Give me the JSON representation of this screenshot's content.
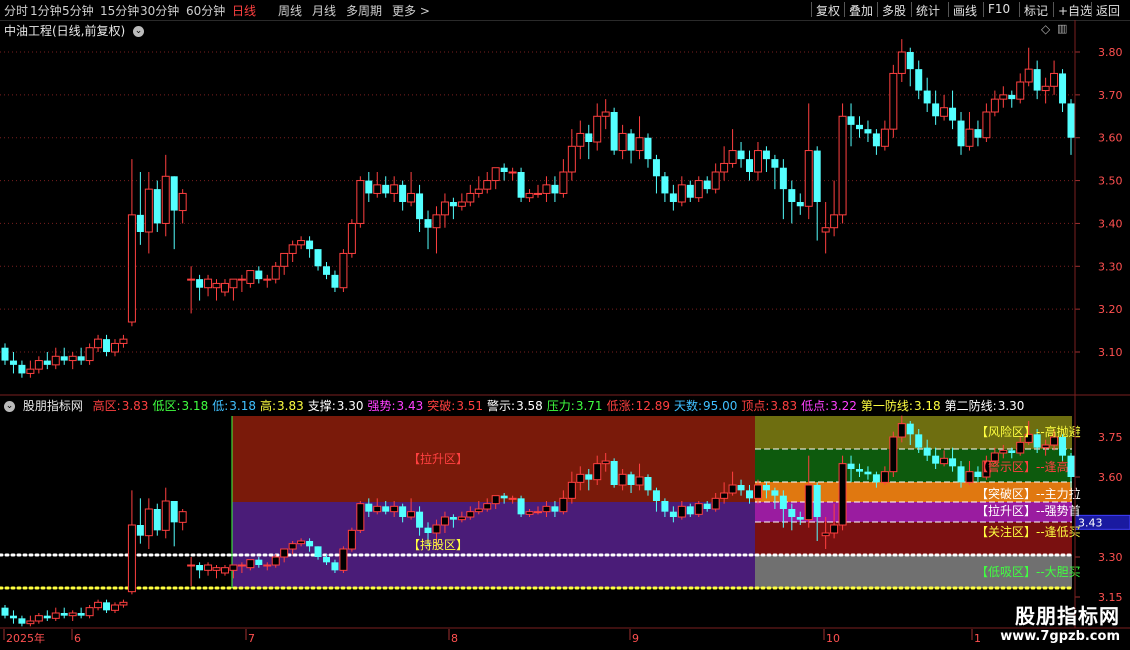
{
  "toolbar": {
    "left": [
      "分时",
      "1分钟",
      "5分钟",
      "15分钟",
      "30分钟",
      "60分钟",
      "日线",
      "周线",
      "月线",
      "多周期",
      "更多 >"
    ],
    "active": "日线",
    "right": [
      "复权",
      "叠加",
      "多股",
      "统计",
      "画线",
      "F10",
      "标记",
      "+自选",
      "返回"
    ]
  },
  "title": "中油工程(日线,前复权)",
  "price_axis": [
    "3.80",
    "3.70",
    "3.60",
    "3.50",
    "3.40",
    "3.30",
    "3.20",
    "3.10"
  ],
  "indicator": {
    "name": "股朋指标网",
    "items": [
      {
        "label": "高区:",
        "value": "3.83",
        "color": "#ff4040"
      },
      {
        "label": "低区:",
        "value": "3.18",
        "color": "#40ff40"
      },
      {
        "label": "低:",
        "value": "3.18",
        "color": "#40c0ff"
      },
      {
        "label": "高:",
        "value": "3.83",
        "color": "#ffff40"
      },
      {
        "label": "支撑:",
        "value": "3.30",
        "color": "#ffffff"
      },
      {
        "label": "强势:",
        "value": "3.43",
        "color": "#ff40ff"
      },
      {
        "label": "突破:",
        "value": "3.51",
        "color": "#ff4040"
      },
      {
        "label": "警示:",
        "value": "3.58",
        "color": "#ffffff"
      },
      {
        "label": "压力:",
        "value": "3.71",
        "color": "#40ff40"
      },
      {
        "label": "低涨:",
        "value": "12.89",
        "color": "#ff4040"
      },
      {
        "label": "天数:",
        "value": "95.00",
        "color": "#40c0ff"
      },
      {
        "label": "顶点:",
        "value": "3.83",
        "color": "#ff4040"
      },
      {
        "label": "低点:",
        "value": "3.22",
        "color": "#ff40ff"
      },
      {
        "label": "第一防线:",
        "value": "3.18",
        "color": "#ffff40"
      },
      {
        "label": "第二防线:",
        "value": "3.30",
        "color": "#ffffff"
      }
    ],
    "axis": [
      "3.75",
      "3.60",
      "3.43",
      "3.30",
      "3.15"
    ],
    "current_tag": "3.43",
    "zone_labels": [
      "【拉升区】",
      "【持股区】"
    ],
    "right_labels": [
      {
        "text": "【风险区】--高抛避",
        "color": "#ffff40"
      },
      {
        "text": "【警示区】--逢高",
        "color": "#ff4040"
      },
      {
        "text": "【突破区】--主力拉",
        "color": "#ffffff"
      },
      {
        "text": "【拉升区】--强势首",
        "color": "#ffffff"
      },
      {
        "text": "【关注区】--逢低买",
        "color": "#ffff40"
      },
      {
        "text": "【低吸区】--大胆买",
        "color": "#40ff40"
      }
    ]
  },
  "date_axis": [
    "2025年",
    "6",
    "7",
    "8",
    "9",
    "10",
    "1"
  ],
  "watermark": {
    "big": "股朋指标网",
    "small": "www.7gpzb.com"
  },
  "colors": {
    "up": "#ff4040",
    "down": "#54ffff",
    "grid": "#7a1f1f"
  },
  "candles": [
    [
      3.11,
      3.08,
      3.12,
      3.07
    ],
    [
      3.08,
      3.07,
      3.1,
      3.05
    ],
    [
      3.07,
      3.05,
      3.08,
      3.04
    ],
    [
      3.05,
      3.06,
      3.08,
      3.04
    ],
    [
      3.06,
      3.08,
      3.09,
      3.05
    ],
    [
      3.08,
      3.07,
      3.1,
      3.06
    ],
    [
      3.07,
      3.09,
      3.11,
      3.06
    ],
    [
      3.09,
      3.08,
      3.11,
      3.07
    ],
    [
      3.08,
      3.09,
      3.1,
      3.06
    ],
    [
      3.09,
      3.08,
      3.11,
      3.07
    ],
    [
      3.08,
      3.11,
      3.12,
      3.07
    ],
    [
      3.11,
      3.13,
      3.14,
      3.1
    ],
    [
      3.13,
      3.1,
      3.14,
      3.09
    ],
    [
      3.1,
      3.12,
      3.13,
      3.09
    ],
    [
      3.12,
      3.13,
      3.14,
      3.11
    ],
    [
      3.17,
      3.42,
      3.55,
      3.16
    ],
    [
      3.42,
      3.38,
      3.52,
      3.35
    ],
    [
      3.38,
      3.48,
      3.52,
      3.33
    ],
    [
      3.48,
      3.4,
      3.5,
      3.38
    ],
    [
      3.4,
      3.51,
      3.56,
      3.37
    ],
    [
      3.51,
      3.43,
      3.51,
      3.34
    ],
    [
      3.43,
      3.47,
      3.48,
      3.4
    ],
    [
      3.27,
      3.27,
      3.3,
      3.19
    ],
    [
      3.27,
      3.25,
      3.28,
      3.22
    ],
    [
      3.25,
      3.27,
      3.28,
      3.23
    ],
    [
      3.25,
      3.26,
      3.27,
      3.22
    ],
    [
      3.24,
      3.26,
      3.27,
      3.23
    ],
    [
      3.25,
      3.27,
      3.27,
      3.22
    ],
    [
      3.27,
      3.27,
      3.28,
      3.24
    ],
    [
      3.26,
      3.29,
      3.29,
      3.25
    ],
    [
      3.29,
      3.27,
      3.3,
      3.26
    ],
    [
      3.27,
      3.27,
      3.28,
      3.25
    ],
    [
      3.27,
      3.3,
      3.31,
      3.26
    ],
    [
      3.3,
      3.33,
      3.33,
      3.28
    ],
    [
      3.33,
      3.35,
      3.36,
      3.31
    ],
    [
      3.35,
      3.36,
      3.37,
      3.34
    ],
    [
      3.36,
      3.34,
      3.37,
      3.32
    ],
    [
      3.34,
      3.3,
      3.34,
      3.29
    ],
    [
      3.3,
      3.28,
      3.31,
      3.27
    ],
    [
      3.28,
      3.25,
      3.29,
      3.24
    ],
    [
      3.25,
      3.33,
      3.34,
      3.24
    ],
    [
      3.33,
      3.4,
      3.41,
      3.32
    ],
    [
      3.4,
      3.5,
      3.51,
      3.39
    ],
    [
      3.5,
      3.47,
      3.52,
      3.45
    ],
    [
      3.47,
      3.49,
      3.52,
      3.46
    ],
    [
      3.49,
      3.47,
      3.51,
      3.46
    ],
    [
      3.47,
      3.49,
      3.51,
      3.45
    ],
    [
      3.49,
      3.45,
      3.5,
      3.43
    ],
    [
      3.45,
      3.47,
      3.52,
      3.44
    ],
    [
      3.47,
      3.41,
      3.49,
      3.38
    ],
    [
      3.41,
      3.39,
      3.43,
      3.34
    ],
    [
      3.39,
      3.42,
      3.44,
      3.33
    ],
    [
      3.42,
      3.45,
      3.47,
      3.39
    ],
    [
      3.45,
      3.44,
      3.46,
      3.41
    ],
    [
      3.44,
      3.45,
      3.47,
      3.43
    ],
    [
      3.45,
      3.47,
      3.49,
      3.44
    ],
    [
      3.47,
      3.48,
      3.51,
      3.46
    ],
    [
      3.48,
      3.5,
      3.52,
      3.47
    ],
    [
      3.5,
      3.53,
      3.53,
      3.48
    ],
    [
      3.53,
      3.52,
      3.54,
      3.5
    ],
    [
      3.52,
      3.52,
      3.53,
      3.5
    ],
    [
      3.52,
      3.46,
      3.53,
      3.45
    ],
    [
      3.46,
      3.47,
      3.48,
      3.45
    ],
    [
      3.47,
      3.47,
      3.49,
      3.46
    ],
    [
      3.47,
      3.49,
      3.51,
      3.45
    ],
    [
      3.49,
      3.47,
      3.51,
      3.45
    ],
    [
      3.47,
      3.52,
      3.55,
      3.46
    ],
    [
      3.52,
      3.58,
      3.62,
      3.5
    ],
    [
      3.58,
      3.61,
      3.64,
      3.55
    ],
    [
      3.61,
      3.59,
      3.63,
      3.55
    ],
    [
      3.59,
      3.65,
      3.68,
      3.57
    ],
    [
      3.65,
      3.66,
      3.69,
      3.62
    ],
    [
      3.66,
      3.57,
      3.67,
      3.56
    ],
    [
      3.57,
      3.61,
      3.63,
      3.55
    ],
    [
      3.61,
      3.57,
      3.62,
      3.54
    ],
    [
      3.57,
      3.6,
      3.65,
      3.55
    ],
    [
      3.6,
      3.55,
      3.61,
      3.53
    ],
    [
      3.55,
      3.51,
      3.56,
      3.47
    ],
    [
      3.51,
      3.47,
      3.52,
      3.45
    ],
    [
      3.47,
      3.45,
      3.49,
      3.43
    ],
    [
      3.45,
      3.49,
      3.51,
      3.44
    ],
    [
      3.49,
      3.46,
      3.5,
      3.45
    ],
    [
      3.46,
      3.5,
      3.51,
      3.45
    ],
    [
      3.5,
      3.48,
      3.51,
      3.47
    ],
    [
      3.48,
      3.52,
      3.54,
      3.47
    ],
    [
      3.52,
      3.54,
      3.58,
      3.5
    ],
    [
      3.54,
      3.57,
      3.62,
      3.53
    ],
    [
      3.57,
      3.55,
      3.59,
      3.53
    ],
    [
      3.55,
      3.52,
      3.57,
      3.5
    ],
    [
      3.52,
      3.57,
      3.59,
      3.5
    ],
    [
      3.57,
      3.55,
      3.58,
      3.52
    ],
    [
      3.55,
      3.53,
      3.56,
      3.48
    ],
    [
      3.53,
      3.48,
      3.55,
      3.41
    ],
    [
      3.48,
      3.45,
      3.5,
      3.4
    ],
    [
      3.45,
      3.44,
      3.47,
      3.42
    ],
    [
      3.44,
      3.57,
      3.68,
      3.41
    ],
    [
      3.57,
      3.45,
      3.58,
      3.36
    ],
    [
      3.38,
      3.39,
      3.45,
      3.33
    ],
    [
      3.39,
      3.42,
      3.5,
      3.37
    ],
    [
      3.42,
      3.65,
      3.68,
      3.4
    ],
    [
      3.65,
      3.63,
      3.68,
      3.58
    ],
    [
      3.63,
      3.62,
      3.65,
      3.6
    ],
    [
      3.62,
      3.61,
      3.64,
      3.59
    ],
    [
      3.61,
      3.58,
      3.62,
      3.56
    ],
    [
      3.58,
      3.62,
      3.64,
      3.57
    ],
    [
      3.62,
      3.75,
      3.77,
      3.6
    ],
    [
      3.75,
      3.8,
      3.83,
      3.73
    ],
    [
      3.8,
      3.76,
      3.81,
      3.72
    ],
    [
      3.76,
      3.71,
      3.78,
      3.69
    ],
    [
      3.71,
      3.68,
      3.74,
      3.66
    ],
    [
      3.68,
      3.65,
      3.71,
      3.63
    ],
    [
      3.65,
      3.67,
      3.7,
      3.64
    ],
    [
      3.67,
      3.64,
      3.71,
      3.62
    ],
    [
      3.64,
      3.58,
      3.66,
      3.56
    ],
    [
      3.58,
      3.62,
      3.66,
      3.57
    ],
    [
      3.62,
      3.6,
      3.64,
      3.58
    ],
    [
      3.6,
      3.66,
      3.68,
      3.59
    ],
    [
      3.66,
      3.69,
      3.71,
      3.65
    ],
    [
      3.69,
      3.7,
      3.72,
      3.67
    ],
    [
      3.7,
      3.69,
      3.71,
      3.67
    ],
    [
      3.69,
      3.73,
      3.75,
      3.68
    ],
    [
      3.73,
      3.76,
      3.81,
      3.72
    ],
    [
      3.76,
      3.71,
      3.78,
      3.69
    ],
    [
      3.71,
      3.72,
      3.74,
      3.68
    ],
    [
      3.72,
      3.75,
      3.78,
      3.7
    ],
    [
      3.75,
      3.68,
      3.76,
      3.66
    ],
    [
      3.68,
      3.6,
      3.69,
      3.56
    ]
  ]
}
